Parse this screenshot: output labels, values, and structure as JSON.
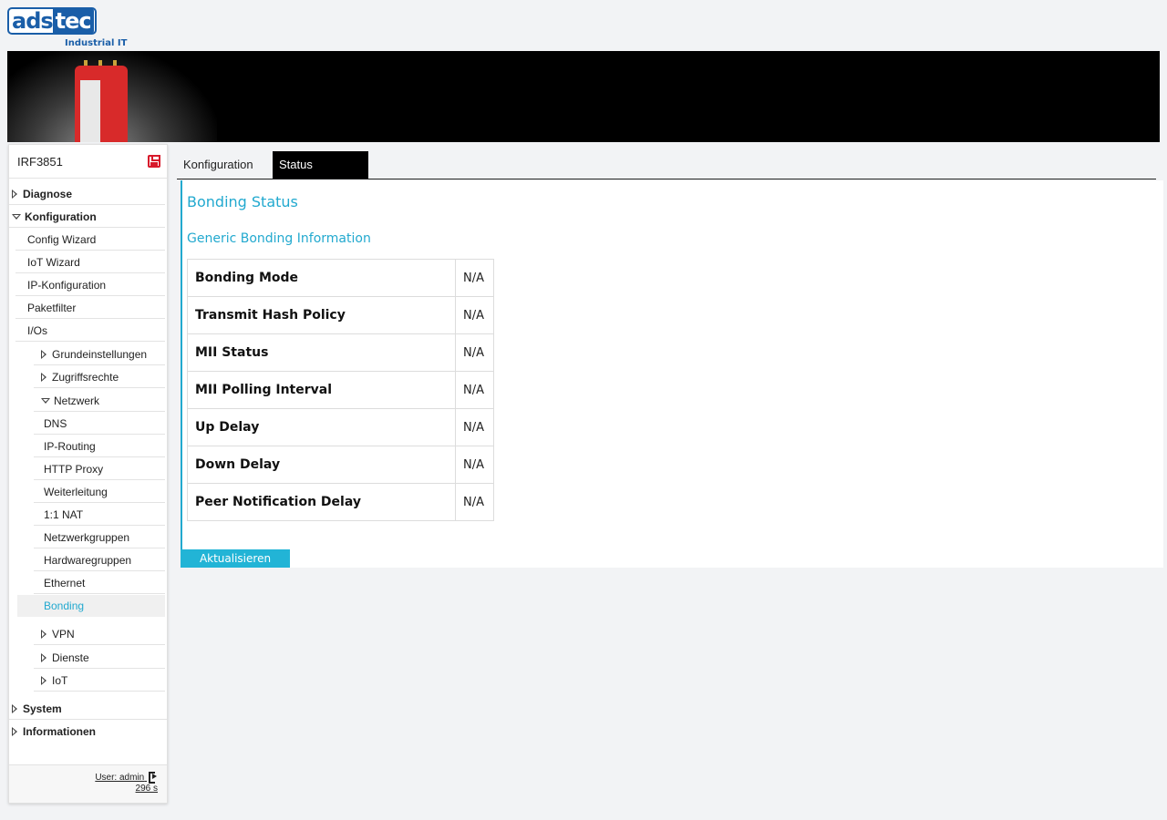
{
  "logo": {
    "brand_left": "ads",
    "brand_right": "tec",
    "subtitle": "Industrial IT"
  },
  "sidebar": {
    "device_name": "IRF3851",
    "save_icon": "save-icon",
    "items": [
      {
        "label": "Diagnose"
      },
      {
        "label": "Konfiguration"
      },
      {
        "label": "Config Wizard"
      },
      {
        "label": "IoT Wizard"
      },
      {
        "label": "IP-Konfiguration"
      },
      {
        "label": "Paketfilter"
      },
      {
        "label": "I/Os"
      },
      {
        "label": "Grundeinstellungen"
      },
      {
        "label": "Zugriffsrechte"
      },
      {
        "label": "Netzwerk"
      },
      {
        "label": "DNS"
      },
      {
        "label": "IP-Routing"
      },
      {
        "label": "HTTP Proxy"
      },
      {
        "label": "Weiterleitung"
      },
      {
        "label": "1:1 NAT"
      },
      {
        "label": "Netzwerkgruppen"
      },
      {
        "label": "Hardwaregruppen"
      },
      {
        "label": "Ethernet"
      },
      {
        "label": "Bonding"
      },
      {
        "label": "VPN"
      },
      {
        "label": "Dienste"
      },
      {
        "label": "IoT"
      },
      {
        "label": "System"
      },
      {
        "label": "Informationen"
      }
    ],
    "user_label": "User: admin",
    "session_timer": "296 s"
  },
  "tabs": [
    {
      "label": "Konfiguration"
    },
    {
      "label": "Status"
    }
  ],
  "main": {
    "title": "Bonding Status",
    "section_title": "Generic Bonding Information",
    "rows": [
      {
        "key": "Bonding Mode",
        "value": "N/A"
      },
      {
        "key": "Transmit Hash Policy",
        "value": "N/A"
      },
      {
        "key": "MII Status",
        "value": "N/A"
      },
      {
        "key": "MII Polling Interval",
        "value": "N/A"
      },
      {
        "key": "Up Delay",
        "value": "N/A"
      },
      {
        "key": "Down Delay",
        "value": "N/A"
      },
      {
        "key": "Peer Notification Delay",
        "value": "N/A"
      }
    ],
    "refresh_label": "Aktualisieren"
  },
  "colors": {
    "accent": "#22a9cf",
    "brand": "#1a5ea8",
    "save_icon": "#d8192b"
  }
}
